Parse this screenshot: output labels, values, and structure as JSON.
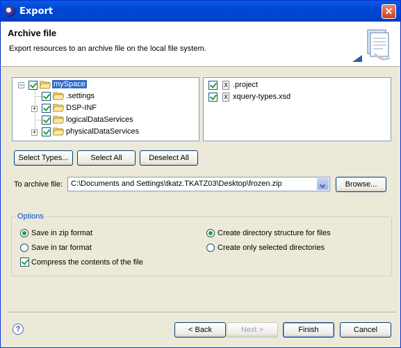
{
  "window": {
    "title": "Export",
    "close_glyph": "✕"
  },
  "banner": {
    "title": "Archive file",
    "description": "Export resources to an archive file on the local file system."
  },
  "tree": {
    "root": {
      "label": "mySpace",
      "checked": true
    },
    "children": [
      {
        "label": ".settings",
        "checked": true,
        "expandable": false
      },
      {
        "label": "DSP-INF",
        "checked": true,
        "expandable": true
      },
      {
        "label": "logicalDataServices",
        "checked": true,
        "expandable": false
      },
      {
        "label": "physicalDataServices",
        "checked": true,
        "expandable": true
      }
    ]
  },
  "files": [
    {
      "label": ".project",
      "checked": true
    },
    {
      "label": "xquery-types.xsd",
      "checked": true
    }
  ],
  "buttons": {
    "select_types": "Select Types...",
    "select_all": "Select All",
    "deselect_all": "Deselect All",
    "browse": "Browse..."
  },
  "archive": {
    "label": "To archive file:",
    "value": "C:\\Documents and Settings\\tkatz.TKATZ03\\Desktop\\frozen.zip"
  },
  "options": {
    "legend": "Options",
    "zip": "Save in zip format",
    "tar": "Save in tar format",
    "compress": "Compress the contents of the file",
    "create_dir": "Create directory structure for files",
    "only_selected": "Create only selected directories",
    "zip_selected": true,
    "create_dir_selected": true,
    "compress_checked": true
  },
  "footer": {
    "help": "?",
    "back": "< Back",
    "next": "Next >",
    "finish": "Finish",
    "cancel": "Cancel"
  }
}
